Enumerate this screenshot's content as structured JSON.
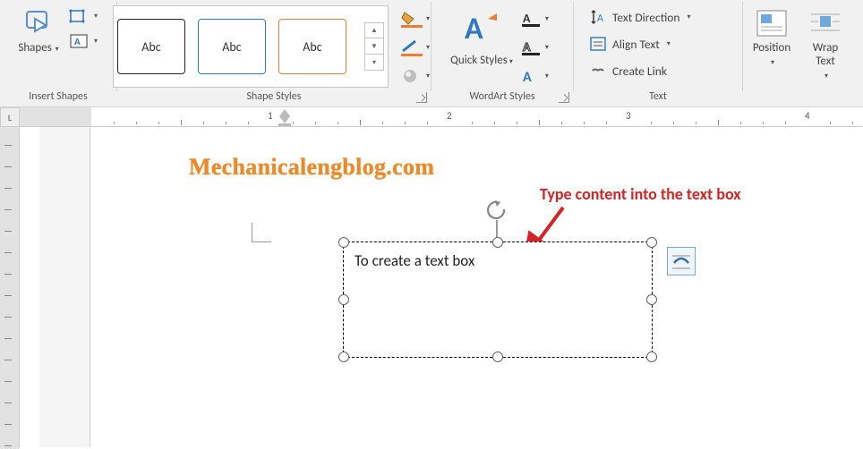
{
  "ribbon": {
    "groups": {
      "insert_shapes": {
        "label": "Insert Shapes",
        "shapes_button": "Shapes"
      },
      "shape_styles": {
        "label": "Shape Styles",
        "gallery_items": [
          "Abc",
          "Abc",
          "Abc"
        ],
        "shape_fill": "Shape Fill",
        "shape_outline": "Shape Outline",
        "shape_effects": "Shape Effects"
      },
      "wordart": {
        "label": "WordArt Styles",
        "quick_styles": "Quick Styles",
        "text_fill": "Text Fill",
        "text_outline": "Text Outline",
        "text_effects": "Text Effects"
      },
      "text": {
        "label": "Text",
        "text_direction": "Text Direction",
        "align_text": "Align Text",
        "create_link": "Create Link"
      },
      "arrange": {
        "position": "Position",
        "wrap_text": "Wrap Text"
      }
    }
  },
  "ruler": {
    "corner": "L",
    "numbers": [
      "1",
      "2",
      "3",
      "4"
    ]
  },
  "document": {
    "watermark": "Mechanicalengblog.com",
    "textbox_content": "To create a text box",
    "callout": "Type content into the text box"
  },
  "icons": {
    "shapes": "shapes-icon",
    "edit_shape": "edit-shape-icon",
    "textbox_new": "textbox-new-icon",
    "bucket": "shape-fill-icon",
    "pen": "shape-outline-icon",
    "effects": "shape-effects-icon",
    "wordart_a": "wordart-a-icon",
    "txt_fill": "text-fill-icon",
    "txt_outline": "text-outline-icon",
    "txt_effects": "text-effects-icon",
    "direction": "text-direction-icon",
    "align": "align-text-icon",
    "link": "create-link-icon",
    "position": "position-icon",
    "wrap": "wrap-text-icon",
    "rotate": "rotate-handle-icon",
    "layout": "layout-options-icon"
  }
}
